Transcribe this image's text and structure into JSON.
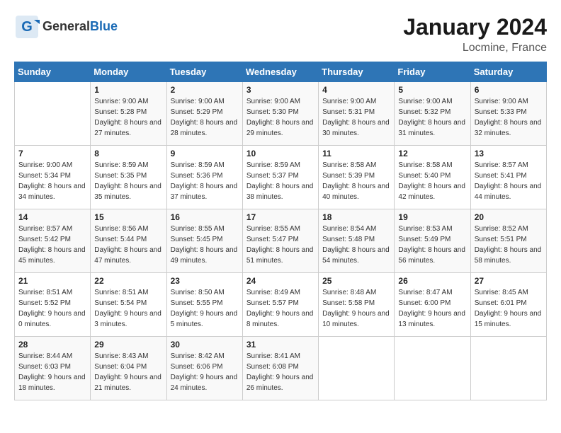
{
  "header": {
    "logo_general": "General",
    "logo_blue": "Blue",
    "month_year": "January 2024",
    "location": "Locmine, France"
  },
  "days_of_week": [
    "Sunday",
    "Monday",
    "Tuesday",
    "Wednesday",
    "Thursday",
    "Friday",
    "Saturday"
  ],
  "weeks": [
    [
      {
        "day": "",
        "sunrise": "",
        "sunset": "",
        "daylight": ""
      },
      {
        "day": "1",
        "sunrise": "Sunrise: 9:00 AM",
        "sunset": "Sunset: 5:28 PM",
        "daylight": "Daylight: 8 hours and 27 minutes."
      },
      {
        "day": "2",
        "sunrise": "Sunrise: 9:00 AM",
        "sunset": "Sunset: 5:29 PM",
        "daylight": "Daylight: 8 hours and 28 minutes."
      },
      {
        "day": "3",
        "sunrise": "Sunrise: 9:00 AM",
        "sunset": "Sunset: 5:30 PM",
        "daylight": "Daylight: 8 hours and 29 minutes."
      },
      {
        "day": "4",
        "sunrise": "Sunrise: 9:00 AM",
        "sunset": "Sunset: 5:31 PM",
        "daylight": "Daylight: 8 hours and 30 minutes."
      },
      {
        "day": "5",
        "sunrise": "Sunrise: 9:00 AM",
        "sunset": "Sunset: 5:32 PM",
        "daylight": "Daylight: 8 hours and 31 minutes."
      },
      {
        "day": "6",
        "sunrise": "Sunrise: 9:00 AM",
        "sunset": "Sunset: 5:33 PM",
        "daylight": "Daylight: 8 hours and 32 minutes."
      }
    ],
    [
      {
        "day": "7",
        "sunrise": "Sunrise: 9:00 AM",
        "sunset": "Sunset: 5:34 PM",
        "daylight": "Daylight: 8 hours and 34 minutes."
      },
      {
        "day": "8",
        "sunrise": "Sunrise: 8:59 AM",
        "sunset": "Sunset: 5:35 PM",
        "daylight": "Daylight: 8 hours and 35 minutes."
      },
      {
        "day": "9",
        "sunrise": "Sunrise: 8:59 AM",
        "sunset": "Sunset: 5:36 PM",
        "daylight": "Daylight: 8 hours and 37 minutes."
      },
      {
        "day": "10",
        "sunrise": "Sunrise: 8:59 AM",
        "sunset": "Sunset: 5:37 PM",
        "daylight": "Daylight: 8 hours and 38 minutes."
      },
      {
        "day": "11",
        "sunrise": "Sunrise: 8:58 AM",
        "sunset": "Sunset: 5:39 PM",
        "daylight": "Daylight: 8 hours and 40 minutes."
      },
      {
        "day": "12",
        "sunrise": "Sunrise: 8:58 AM",
        "sunset": "Sunset: 5:40 PM",
        "daylight": "Daylight: 8 hours and 42 minutes."
      },
      {
        "day": "13",
        "sunrise": "Sunrise: 8:57 AM",
        "sunset": "Sunset: 5:41 PM",
        "daylight": "Daylight: 8 hours and 44 minutes."
      }
    ],
    [
      {
        "day": "14",
        "sunrise": "Sunrise: 8:57 AM",
        "sunset": "Sunset: 5:42 PM",
        "daylight": "Daylight: 8 hours and 45 minutes."
      },
      {
        "day": "15",
        "sunrise": "Sunrise: 8:56 AM",
        "sunset": "Sunset: 5:44 PM",
        "daylight": "Daylight: 8 hours and 47 minutes."
      },
      {
        "day": "16",
        "sunrise": "Sunrise: 8:55 AM",
        "sunset": "Sunset: 5:45 PM",
        "daylight": "Daylight: 8 hours and 49 minutes."
      },
      {
        "day": "17",
        "sunrise": "Sunrise: 8:55 AM",
        "sunset": "Sunset: 5:47 PM",
        "daylight": "Daylight: 8 hours and 51 minutes."
      },
      {
        "day": "18",
        "sunrise": "Sunrise: 8:54 AM",
        "sunset": "Sunset: 5:48 PM",
        "daylight": "Daylight: 8 hours and 54 minutes."
      },
      {
        "day": "19",
        "sunrise": "Sunrise: 8:53 AM",
        "sunset": "Sunset: 5:49 PM",
        "daylight": "Daylight: 8 hours and 56 minutes."
      },
      {
        "day": "20",
        "sunrise": "Sunrise: 8:52 AM",
        "sunset": "Sunset: 5:51 PM",
        "daylight": "Daylight: 8 hours and 58 minutes."
      }
    ],
    [
      {
        "day": "21",
        "sunrise": "Sunrise: 8:51 AM",
        "sunset": "Sunset: 5:52 PM",
        "daylight": "Daylight: 9 hours and 0 minutes."
      },
      {
        "day": "22",
        "sunrise": "Sunrise: 8:51 AM",
        "sunset": "Sunset: 5:54 PM",
        "daylight": "Daylight: 9 hours and 3 minutes."
      },
      {
        "day": "23",
        "sunrise": "Sunrise: 8:50 AM",
        "sunset": "Sunset: 5:55 PM",
        "daylight": "Daylight: 9 hours and 5 minutes."
      },
      {
        "day": "24",
        "sunrise": "Sunrise: 8:49 AM",
        "sunset": "Sunset: 5:57 PM",
        "daylight": "Daylight: 9 hours and 8 minutes."
      },
      {
        "day": "25",
        "sunrise": "Sunrise: 8:48 AM",
        "sunset": "Sunset: 5:58 PM",
        "daylight": "Daylight: 9 hours and 10 minutes."
      },
      {
        "day": "26",
        "sunrise": "Sunrise: 8:47 AM",
        "sunset": "Sunset: 6:00 PM",
        "daylight": "Daylight: 9 hours and 13 minutes."
      },
      {
        "day": "27",
        "sunrise": "Sunrise: 8:45 AM",
        "sunset": "Sunset: 6:01 PM",
        "daylight": "Daylight: 9 hours and 15 minutes."
      }
    ],
    [
      {
        "day": "28",
        "sunrise": "Sunrise: 8:44 AM",
        "sunset": "Sunset: 6:03 PM",
        "daylight": "Daylight: 9 hours and 18 minutes."
      },
      {
        "day": "29",
        "sunrise": "Sunrise: 8:43 AM",
        "sunset": "Sunset: 6:04 PM",
        "daylight": "Daylight: 9 hours and 21 minutes."
      },
      {
        "day": "30",
        "sunrise": "Sunrise: 8:42 AM",
        "sunset": "Sunset: 6:06 PM",
        "daylight": "Daylight: 9 hours and 24 minutes."
      },
      {
        "day": "31",
        "sunrise": "Sunrise: 8:41 AM",
        "sunset": "Sunset: 6:08 PM",
        "daylight": "Daylight: 9 hours and 26 minutes."
      },
      {
        "day": "",
        "sunrise": "",
        "sunset": "",
        "daylight": ""
      },
      {
        "day": "",
        "sunrise": "",
        "sunset": "",
        "daylight": ""
      },
      {
        "day": "",
        "sunrise": "",
        "sunset": "",
        "daylight": ""
      }
    ]
  ]
}
